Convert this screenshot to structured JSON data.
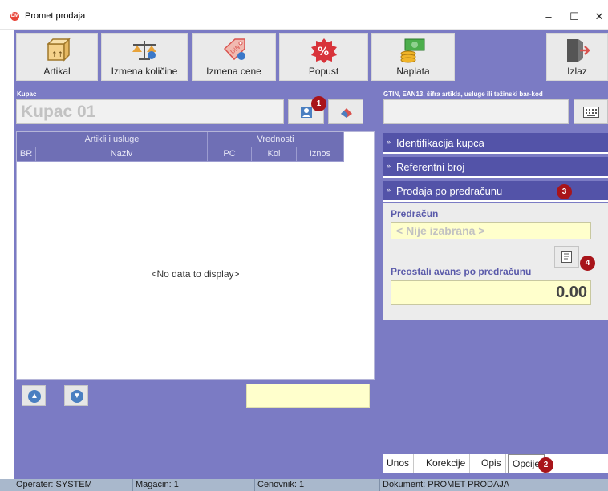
{
  "window": {
    "title": "Promet prodaja",
    "icon_text": "DM"
  },
  "toolbar": {
    "artikal": "Artikal",
    "izmena_kolicine": "Izmena količine",
    "izmena_cene": "Izmena cene",
    "popust": "Popust",
    "naplata": "Naplata",
    "izlaz": "Izlaz"
  },
  "customer": {
    "label": "Kupac",
    "value": "Kupac 01"
  },
  "barcode": {
    "label": "GTIN, EAN13, šifra artikla, usluge ili težinski bar-kod",
    "value": ""
  },
  "grid": {
    "group1": "Artikli i usluge",
    "group2": "Vrednosti",
    "columns": [
      "BR",
      "Naziv",
      "PC",
      "Kol",
      "Iznos"
    ],
    "empty": "<No data to display>"
  },
  "panels": {
    "identifikacija": "Identifikacija kupca",
    "referentni": "Referentni broj",
    "predracun_header": "Prodaja po predračunu"
  },
  "predracun": {
    "label": "Predračun",
    "value": "< Nije izabrana >",
    "avans_label": "Preostali avans po predračunu",
    "avans_value": "0.00"
  },
  "tabs": [
    "Unos",
    "Korekcije",
    "Opis",
    "Opcije"
  ],
  "badges": [
    "1",
    "2",
    "3",
    "4"
  ],
  "status": {
    "operater": "Operater: SYSTEM",
    "magacin": "Magacin: 1",
    "cenovnik": "Cenovnik: 1",
    "dokument": "Dokument: PROMET PRODAJA"
  },
  "colors": {
    "background": "#7b7bc4",
    "header": "#6f6fb5",
    "panel": "#5353a8",
    "badge": "#a8141a",
    "field": "#ffffcc"
  }
}
